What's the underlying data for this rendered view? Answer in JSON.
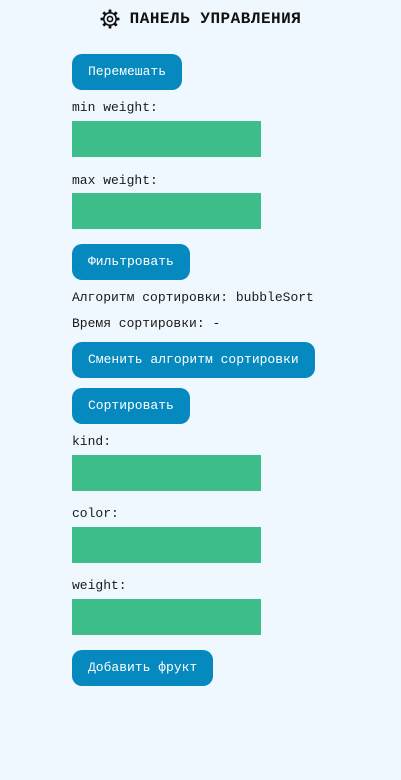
{
  "header": {
    "title": "ПАНЕЛЬ УПРАВЛЕНИЯ",
    "icon": "gear-icon"
  },
  "controls": {
    "shuffle_label": "Перемешать",
    "min_weight_label": "min weight:",
    "min_weight_value": "",
    "max_weight_label": "max weight:",
    "max_weight_value": "",
    "filter_label": "Фильтровать",
    "sort_algorithm_caption": "Алгоритм сортировки:",
    "sort_algorithm_value": "bubbleSort",
    "sort_time_caption": "Время сортировки:",
    "sort_time_value": "-",
    "change_algorithm_label": "Сменить алгоритм сортировки",
    "sort_label": "Сортировать"
  },
  "add_fruit": {
    "kind_label": "kind:",
    "kind_value": "",
    "color_label": "color:",
    "color_value": "",
    "weight_label": "weight:",
    "weight_value": "",
    "add_label": "Добавить фрукт"
  },
  "colors": {
    "background": "#f0f8ff",
    "button": "#0689bf",
    "input": "#3dbd8a"
  }
}
